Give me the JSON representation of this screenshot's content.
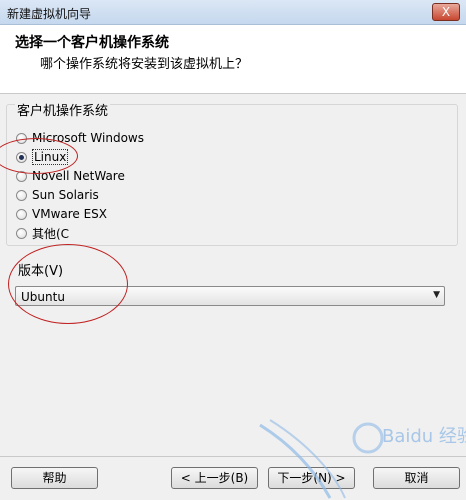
{
  "window": {
    "title": "新建虚拟机向导",
    "close_glyph": "X"
  },
  "header": {
    "title": "选择一个客户机操作系统",
    "subtitle": "哪个操作系统将安装到该虚拟机上？"
  },
  "guest_os": {
    "group_label": "客户机操作系统",
    "options": [
      {
        "label": "Microsoft Windows",
        "checked": false
      },
      {
        "label": "Linux",
        "checked": true
      },
      {
        "label": "Novell NetWare",
        "checked": false
      },
      {
        "label": "Sun Solaris",
        "checked": false
      },
      {
        "label": "VMware ESX",
        "checked": false
      },
      {
        "label": "其他(C",
        "checked": false
      }
    ]
  },
  "version": {
    "label": "版本(V)",
    "selected": "Ubuntu"
  },
  "buttons": {
    "help": "帮助",
    "back": "< 上一步(B)",
    "next": "下一步(N) >",
    "cancel": "取消"
  },
  "watermark": {
    "text": "Baidu 经验"
  },
  "colors": {
    "annotation": "#c02020",
    "title_bar": "#c5d8ee"
  }
}
